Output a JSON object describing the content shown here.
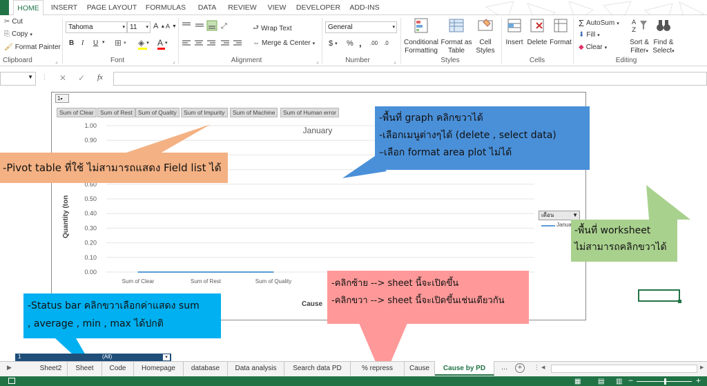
{
  "menu_tabs": [
    "HOME",
    "INSERT",
    "PAGE LAYOUT",
    "FORMULAS",
    "DATA",
    "REVIEW",
    "VIEW",
    "DEVELOPER",
    "ADD-INS"
  ],
  "clipboard": {
    "cut": "Cut",
    "copy": "Copy",
    "format_painter": "Format Painter",
    "label": "Clipboard"
  },
  "font": {
    "name": "Tahoma",
    "size": "11",
    "label": "Font",
    "bold": "B",
    "italic": "I",
    "underline": "U",
    "grow": "A",
    "shrink": "A"
  },
  "alignment": {
    "wrap": "Wrap Text",
    "merge": "Merge & Center",
    "label": "Alignment"
  },
  "number": {
    "format": "General",
    "currency": "$",
    "percent": "%",
    "comma": ",",
    "label": "Number",
    "inc_dec": ".00",
    "dec_dec": ".0"
  },
  "styles": {
    "conditional": [
      "Conditional",
      "Formatting"
    ],
    "format_as": [
      "Format as",
      "Table"
    ],
    "cell": [
      "Cell",
      "Styles"
    ],
    "label": "Styles"
  },
  "cells": {
    "insert": "Insert",
    "delete": "Delete",
    "format": "Format",
    "label": "Cells"
  },
  "editing": {
    "autosum": "AutoSum",
    "fill": "Fill",
    "clear": "Clear",
    "sort": [
      "Sort &",
      "Filter"
    ],
    "find": [
      "Find &",
      "Select"
    ],
    "label": "Editing"
  },
  "formula_bar": {
    "fx": "fx",
    "cancel": "✕",
    "enter": "✓"
  },
  "pivot": {
    "filter_btn": "1",
    "legend_filter": "เดือน",
    "legend_item": "Janua",
    "fields": [
      "Sum of Clear",
      "Sum of Rest",
      "Sum of Quality",
      "Sum of Impurity",
      "Sum of Machine",
      "Sum of Human error"
    ],
    "row_label": "1",
    "all_label": "(All)"
  },
  "chart_data": {
    "type": "line",
    "title": "January",
    "ylabel": "Quantity (ton",
    "xlabel": "Cause",
    "ylim": [
      0,
      1
    ],
    "yticks": [
      "1.00",
      "0.90",
      "0.80",
      "0.70",
      "0.60",
      "0.50",
      "0.40",
      "0.30",
      "0.20",
      "0.10",
      "0.00"
    ],
    "categories": [
      "Sum of Clear",
      "Sum of Rest",
      "Sum of Quality"
    ],
    "series": [
      {
        "name": "Janua",
        "values": [
          0,
          0,
          0
        ],
        "color": "#5b9bd5"
      }
    ]
  },
  "callouts": {
    "graph": [
      "-พื้นที่ graph คลิกขวาได้",
      "-เลือกเมนูต่างๆได้ (delete , select data)",
      "–เลือก format area plot ไม่ได้"
    ],
    "pivot": "-Pivot table ที่ใช้ ไม่สามารถแสดง Field list ได้",
    "worksheet": [
      "-พื้นที่ worksheet",
      "ไม่สามารถคลิกขวาได้"
    ],
    "tabs": [
      "-คลิกซ้าย --> sheet นี้จะเปิดขึ้น",
      "-คลิกขวา --> sheet นี้จะเปิดขึ้นเช่นเดียวกัน"
    ],
    "status": [
      "-Status bar คลิกขวาเลือกค่าแสดง sum",
      ", average , min , max ได้ปกติ"
    ]
  },
  "sheet_tabs": [
    "Sheet2",
    "Sheet",
    "Code",
    "Homepage",
    "database",
    "Data analysis",
    "Search data PD",
    "% repress",
    "Cause",
    "Cause by PD"
  ],
  "active_tab": "Cause by PD",
  "tab_more": "...",
  "tab_add": "+",
  "colors": {
    "excel_green": "#217346",
    "blue_callout": "#4a90d9",
    "orange_callout": "#f4b183",
    "green_callout": "#a9d18e",
    "pink_callout": "#ff9999",
    "cyan_callout": "#00b0f0"
  }
}
